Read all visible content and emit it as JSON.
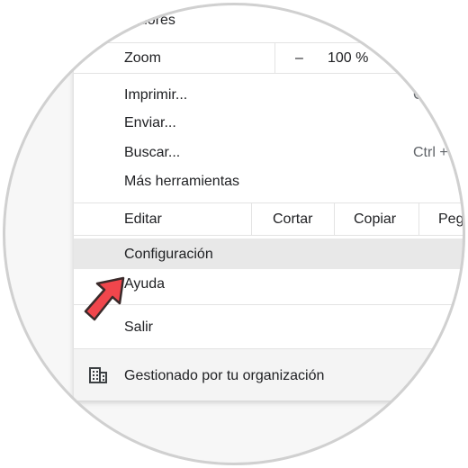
{
  "menu": {
    "top_label": "cadores",
    "zoom": {
      "label": "Zoom",
      "minus": "–",
      "value": "100 %"
    },
    "print": {
      "label": "Imprimir...",
      "shortcut": "C"
    },
    "send": {
      "label": "Enviar..."
    },
    "find": {
      "label": "Buscar...",
      "shortcut": "Ctrl +"
    },
    "more_tools": {
      "label": "Más herramientas"
    },
    "edit": {
      "label": "Editar",
      "cut": "Cortar",
      "copy": "Copiar",
      "paste": "Peg"
    },
    "settings": {
      "label": "Configuración"
    },
    "help": {
      "label": "Ayuda"
    },
    "exit": {
      "label": "Salir"
    },
    "managed": {
      "label": "Gestionado por tu organización",
      "icon": "building-icon"
    }
  },
  "pointer": {
    "icon": "arrow-pointer-icon",
    "color": "#f0464c"
  },
  "colors": {
    "highlight": "#e8e8e8",
    "text": "#202124",
    "shortcut_text": "#5f6368"
  }
}
